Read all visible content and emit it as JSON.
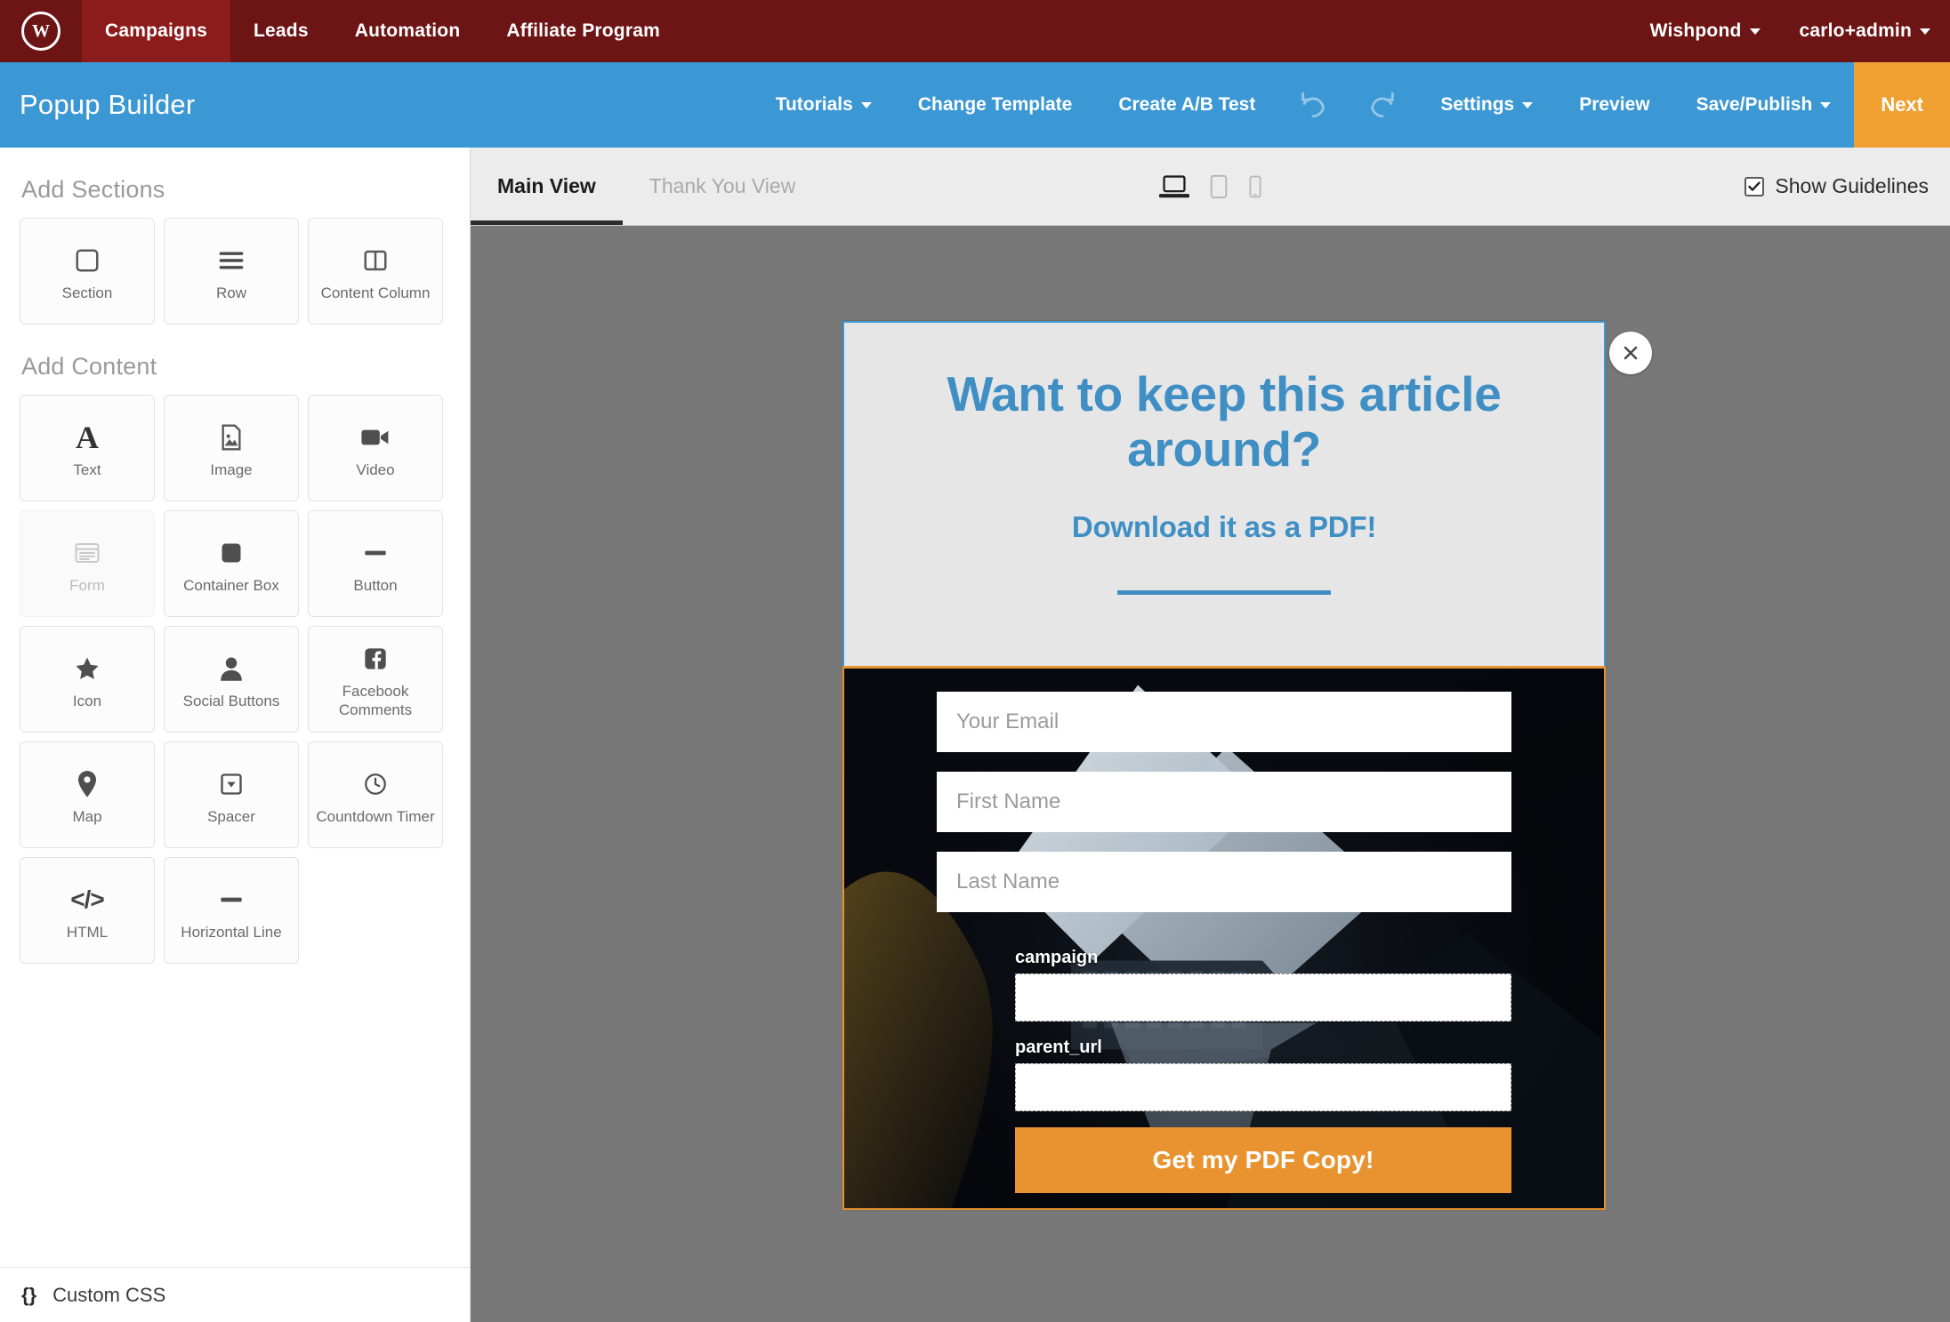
{
  "topnav": {
    "logo_letter": "W",
    "items": [
      {
        "label": "Campaigns",
        "active": true
      },
      {
        "label": "Leads",
        "active": false
      },
      {
        "label": "Automation",
        "active": false
      },
      {
        "label": "Affiliate Program",
        "active": false
      }
    ],
    "right": [
      {
        "label": "Wishpond",
        "caret": true
      },
      {
        "label": "carlo+admin",
        "caret": true
      }
    ],
    "bg_color": "#6d1414",
    "active_color": "#8c1c1c"
  },
  "toolbar": {
    "title": "Popup Builder",
    "tutorials": "Tutorials",
    "change_template": "Change Template",
    "create_ab_test": "Create A/B Test",
    "undo_icon": "undo-icon",
    "redo_icon": "redo-icon",
    "settings": "Settings",
    "preview": "Preview",
    "save_publish": "Save/Publish",
    "next": "Next",
    "bg_color": "#3c98d4",
    "next_color": "#f0a030"
  },
  "sidebar": {
    "sections_heading": "Add Sections",
    "sections": [
      {
        "label": "Section",
        "icon": "square-outline-icon"
      },
      {
        "label": "Row",
        "icon": "rows-icon"
      },
      {
        "label": "Content Column",
        "icon": "two-column-icon"
      }
    ],
    "content_heading": "Add Content",
    "content": [
      {
        "label": "Text",
        "icon": "text-a-icon",
        "disabled": false
      },
      {
        "label": "Image",
        "icon": "image-icon",
        "disabled": false
      },
      {
        "label": "Video",
        "icon": "video-camera-icon",
        "disabled": false
      },
      {
        "label": "Form",
        "icon": "form-icon",
        "disabled": true
      },
      {
        "label": "Container Box",
        "icon": "filled-square-icon",
        "disabled": false
      },
      {
        "label": "Button",
        "icon": "dash-icon",
        "disabled": false
      },
      {
        "label": "Icon",
        "icon": "star-icon",
        "disabled": false
      },
      {
        "label": "Social Buttons",
        "icon": "person-icon",
        "disabled": false
      },
      {
        "label": "Facebook Comments",
        "icon": "facebook-icon",
        "disabled": false
      },
      {
        "label": "Map",
        "icon": "map-pin-icon",
        "disabled": false
      },
      {
        "label": "Spacer",
        "icon": "spacer-icon",
        "disabled": false
      },
      {
        "label": "Countdown Timer",
        "icon": "clock-icon",
        "disabled": false
      },
      {
        "label": "HTML",
        "icon": "code-icon",
        "disabled": false
      },
      {
        "label": "Horizontal Line",
        "icon": "dash-icon",
        "disabled": false
      }
    ],
    "custom_css": "Custom CSS",
    "custom_css_icon": "curly-braces-icon"
  },
  "viewbar": {
    "tabs": [
      {
        "label": "Main View",
        "active": true
      },
      {
        "label": "Thank You View",
        "active": false
      }
    ],
    "devices": [
      {
        "name": "desktop-icon",
        "active": true
      },
      {
        "name": "tablet-icon",
        "active": false
      },
      {
        "name": "mobile-icon",
        "active": false
      }
    ],
    "guidelines_label": "Show Guidelines",
    "guidelines_checked": true
  },
  "popup": {
    "headline": "Want to keep this article around?",
    "subheadline": "Download it as a PDF!",
    "close_icon": "close-x-icon",
    "top_bg": "#e6e6e6",
    "top_border": "#3c98d4",
    "accent_blue": "#3f8fc4",
    "accent_orange": "#e8932f",
    "fields": [
      {
        "placeholder": "Your Email",
        "name": "email-field"
      },
      {
        "placeholder": "First Name",
        "name": "first-name-field"
      },
      {
        "placeholder": "Last Name",
        "name": "last-name-field"
      }
    ],
    "hidden_fields": [
      {
        "label": "campaign",
        "value": ""
      },
      {
        "label": "parent_url",
        "value": ""
      }
    ],
    "submit_label": "Get my PDF Copy!"
  },
  "canvas": {
    "bg_color": "#787878"
  }
}
